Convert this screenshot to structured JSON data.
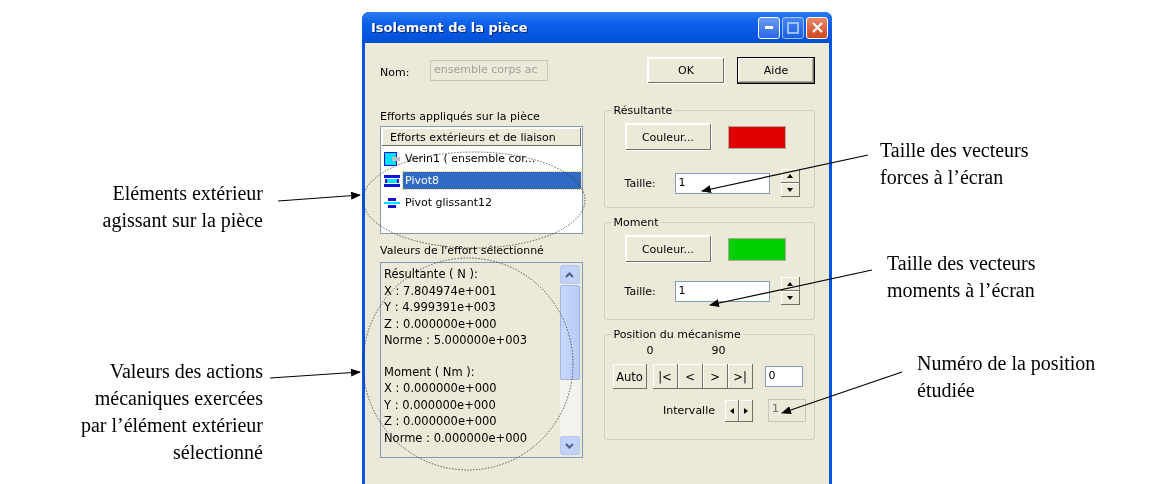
{
  "annotations_left": [
    {
      "text": "Eléments extérieur\nagissant sur la pièce"
    },
    {
      "text": "Valeurs des actions\nmécaniques exercées\npar l’élément extérieur\nsélectionné"
    }
  ],
  "annotations_right": [
    {
      "text": "Taille des vecteurs\nforces à l’écran"
    },
    {
      "text": "Taille des vecteurs\nmoments à l’écran"
    },
    {
      "text": "Numéro de la position\nétudiée"
    }
  ],
  "window": {
    "title": "Isolement de la pièce"
  },
  "name_field": {
    "label": "Nom:",
    "value": "ensemble corps ac",
    "disabled": true
  },
  "buttons": [
    {
      "label": "OK",
      "default": false
    },
    {
      "label": "Aide",
      "default": true
    }
  ],
  "efforts": {
    "label": "Efforts appliqués sur la pièce",
    "column": "Efforts extérieurs et de liaison",
    "items": [
      {
        "kind": "verin",
        "label": "Verin1 ( ensemble cor...",
        "selected": false
      },
      {
        "kind": "pivot",
        "label": "Pivot8",
        "selected": true
      },
      {
        "kind": "glissant",
        "label": "Pivot glissant12",
        "selected": false
      }
    ]
  },
  "values": {
    "label": "Valeurs de l'effort sélectionné",
    "sections": [
      {
        "heading": "Résultante ( N ):",
        "lines": [
          "X : 7.804974e+001",
          "Y : 4.999391e+003",
          "Z : 0.000000e+000",
          "Norme : 5.000000e+003"
        ]
      },
      {
        "heading": "Moment ( Nm ):",
        "lines": [
          "X : 0.000000e+000",
          "Y : 0.000000e+000",
          "Z : 0.000000e+000",
          "Norme : 0.000000e+000"
        ]
      }
    ]
  },
  "resultante": {
    "title": "Résultante",
    "button": "Couleur...",
    "color": "#e00000",
    "size_label": "Taille:",
    "size": "1"
  },
  "moment": {
    "title": "Moment",
    "button": "Couleur...",
    "color": "#00d000",
    "size_label": "Taille:",
    "size": "1"
  },
  "position": {
    "title": "Position du mécanisme",
    "min": "0",
    "max": "90",
    "auto": "Auto",
    "nav": [
      "|<",
      "<",
      ">",
      ">|"
    ],
    "value": "0",
    "interval_label": "Intervalle",
    "interval": "1",
    "interval_disabled": true
  }
}
